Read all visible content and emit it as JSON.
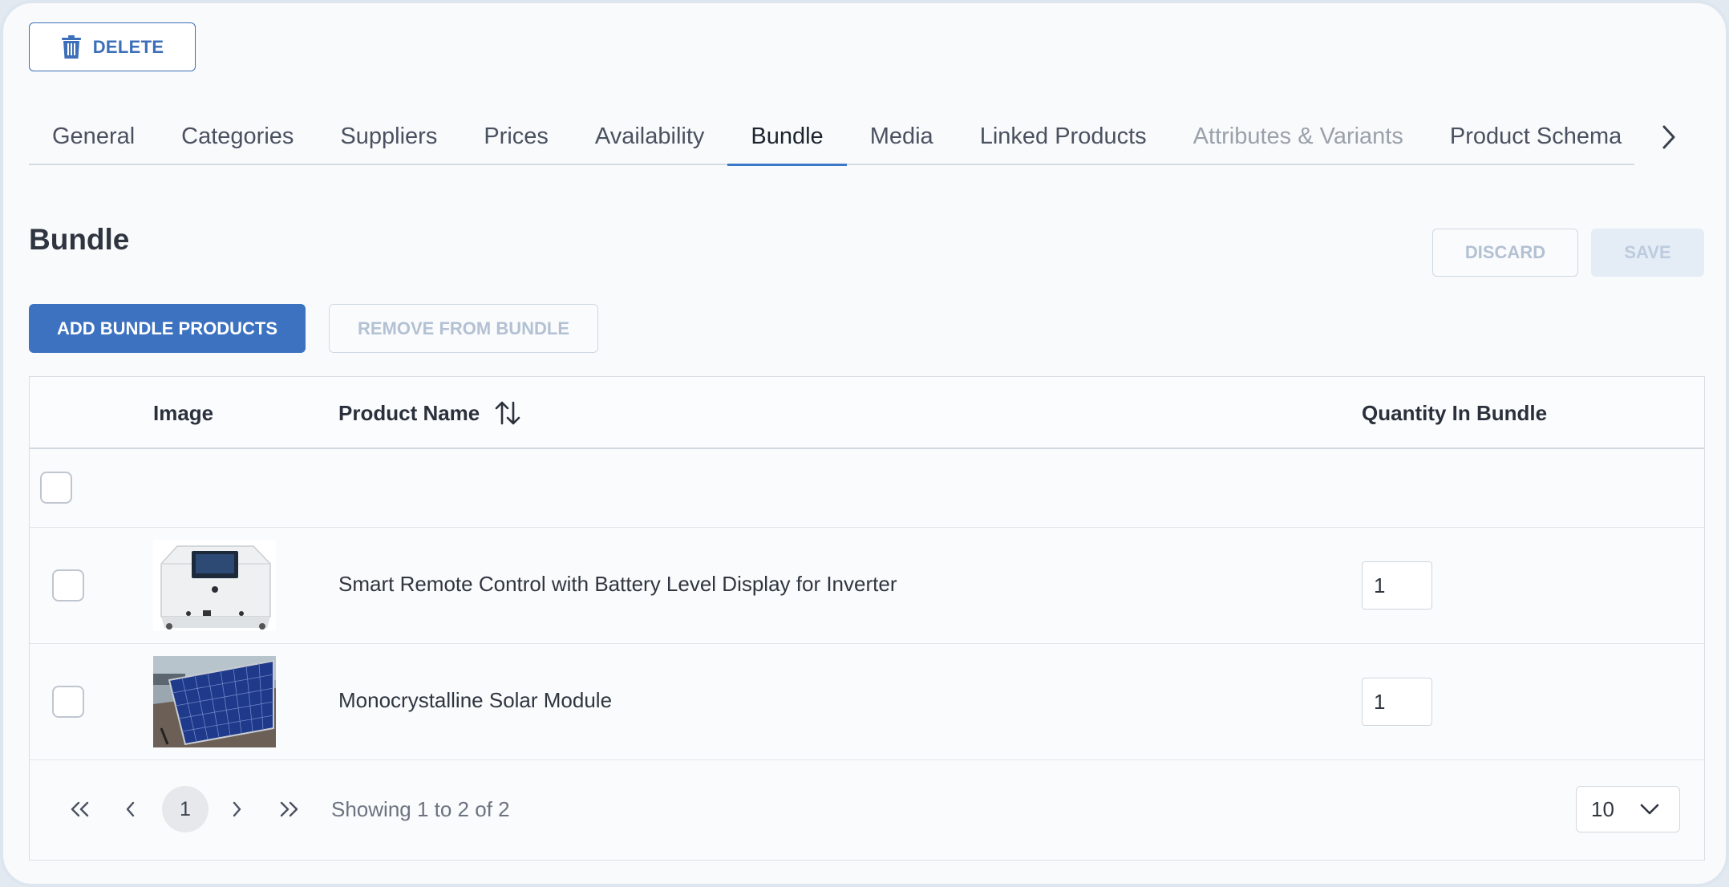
{
  "toolbar": {
    "delete_label": "DELETE"
  },
  "tabs": [
    {
      "label": "General",
      "state": "normal"
    },
    {
      "label": "Categories",
      "state": "normal"
    },
    {
      "label": "Suppliers",
      "state": "normal"
    },
    {
      "label": "Prices",
      "state": "normal"
    },
    {
      "label": "Availability",
      "state": "normal"
    },
    {
      "label": "Bundle",
      "state": "active"
    },
    {
      "label": "Media",
      "state": "normal"
    },
    {
      "label": "Linked Products",
      "state": "normal"
    },
    {
      "label": "Attributes & Variants",
      "state": "disabled"
    },
    {
      "label": "Product Schema",
      "state": "normal"
    }
  ],
  "section": {
    "title": "Bundle",
    "discard_label": "DISCARD",
    "save_label": "SAVE",
    "add_label": "ADD BUNDLE PRODUCTS",
    "remove_label": "REMOVE FROM BUNDLE"
  },
  "table": {
    "headers": {
      "image": "Image",
      "name": "Product Name",
      "quantity": "Quantity In Bundle"
    },
    "rows": [
      {
        "name": "Smart Remote Control with Battery Level Display for Inverter",
        "quantity": "1",
        "image": "remote-control-device"
      },
      {
        "name": "Monocrystalline Solar Module",
        "quantity": "1",
        "image": "solar-panel-on-roof"
      }
    ]
  },
  "pagination": {
    "current_page": "1",
    "showing_text": "Showing 1 to 2 of 2",
    "per_page": "10"
  },
  "colors": {
    "primary": "#3d72c1",
    "tab_active_underline": "#3c78c8",
    "disabled_text": "#b3c1d3"
  }
}
